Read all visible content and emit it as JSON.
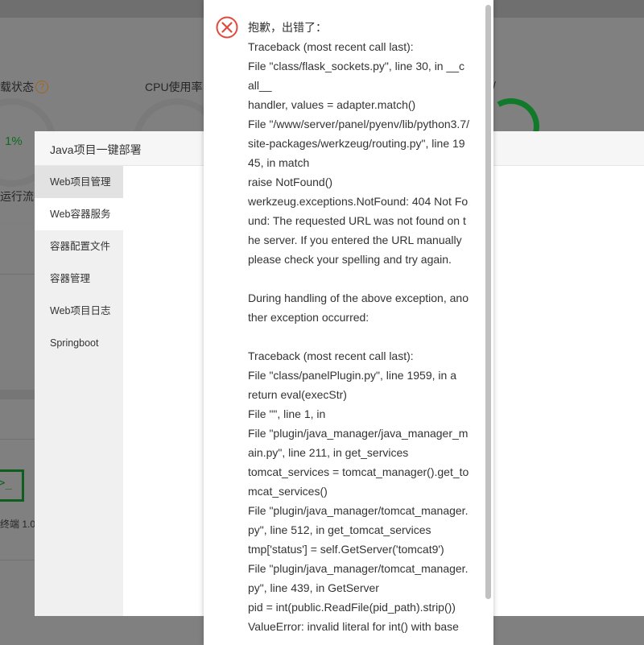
{
  "background": {
    "status_label": "载状态",
    "cpu_label": "CPU使用率",
    "slash": "/",
    "gauge_value": "1%",
    "flow_label": "运行流畅",
    "terminal_label": "终端 1.0",
    "help_glyph": "?"
  },
  "modal": {
    "title": "Java项目一键部署",
    "sidebar": [
      {
        "label": "Web项目管理"
      },
      {
        "label": "Web容器服务"
      },
      {
        "label": "容器配置文件"
      },
      {
        "label": "容器管理"
      },
      {
        "label": "Web项目日志"
      },
      {
        "label": "Springboot"
      }
    ]
  },
  "error_dialog": {
    "icon": "error-circle-icon",
    "message": "抱歉，出错了：\nTraceback (most recent call last):\nFile \"class/flask_sockets.py\", line 30, in __call__\nhandler, values = adapter.match()\nFile \"/www/server/panel/pyenv/lib/python3.7/site-packages/werkzeug/routing.py\", line 1945, in match\nraise NotFound()\nwerkzeug.exceptions.NotFound: 404 Not Found: The requested URL was not found on the server. If you entered the URL manually please check your spelling and try again.\n\nDuring handling of the above exception, another exception occurred:\n\nTraceback (most recent call last):\nFile \"class/panelPlugin.py\", line 1959, in a\nreturn eval(execStr)\nFile \"\", line 1, in\nFile \"plugin/java_manager/java_manager_main.py\", line 211, in get_services\ntomcat_services = tomcat_manager().get_tomcat_services()\nFile \"plugin/java_manager/tomcat_manager.py\", line 512, in get_tomcat_services\ntmp['status'] = self.GetServer('tomcat9')\nFile \"plugin/java_manager/tomcat_manager.py\", line 439, in GetServer\npid = int(public.ReadFile(pid_path).strip())\nValueError: invalid literal for int() with base"
  },
  "colors": {
    "error_red": "#e0493c",
    "accent_green": "#117a2a"
  }
}
